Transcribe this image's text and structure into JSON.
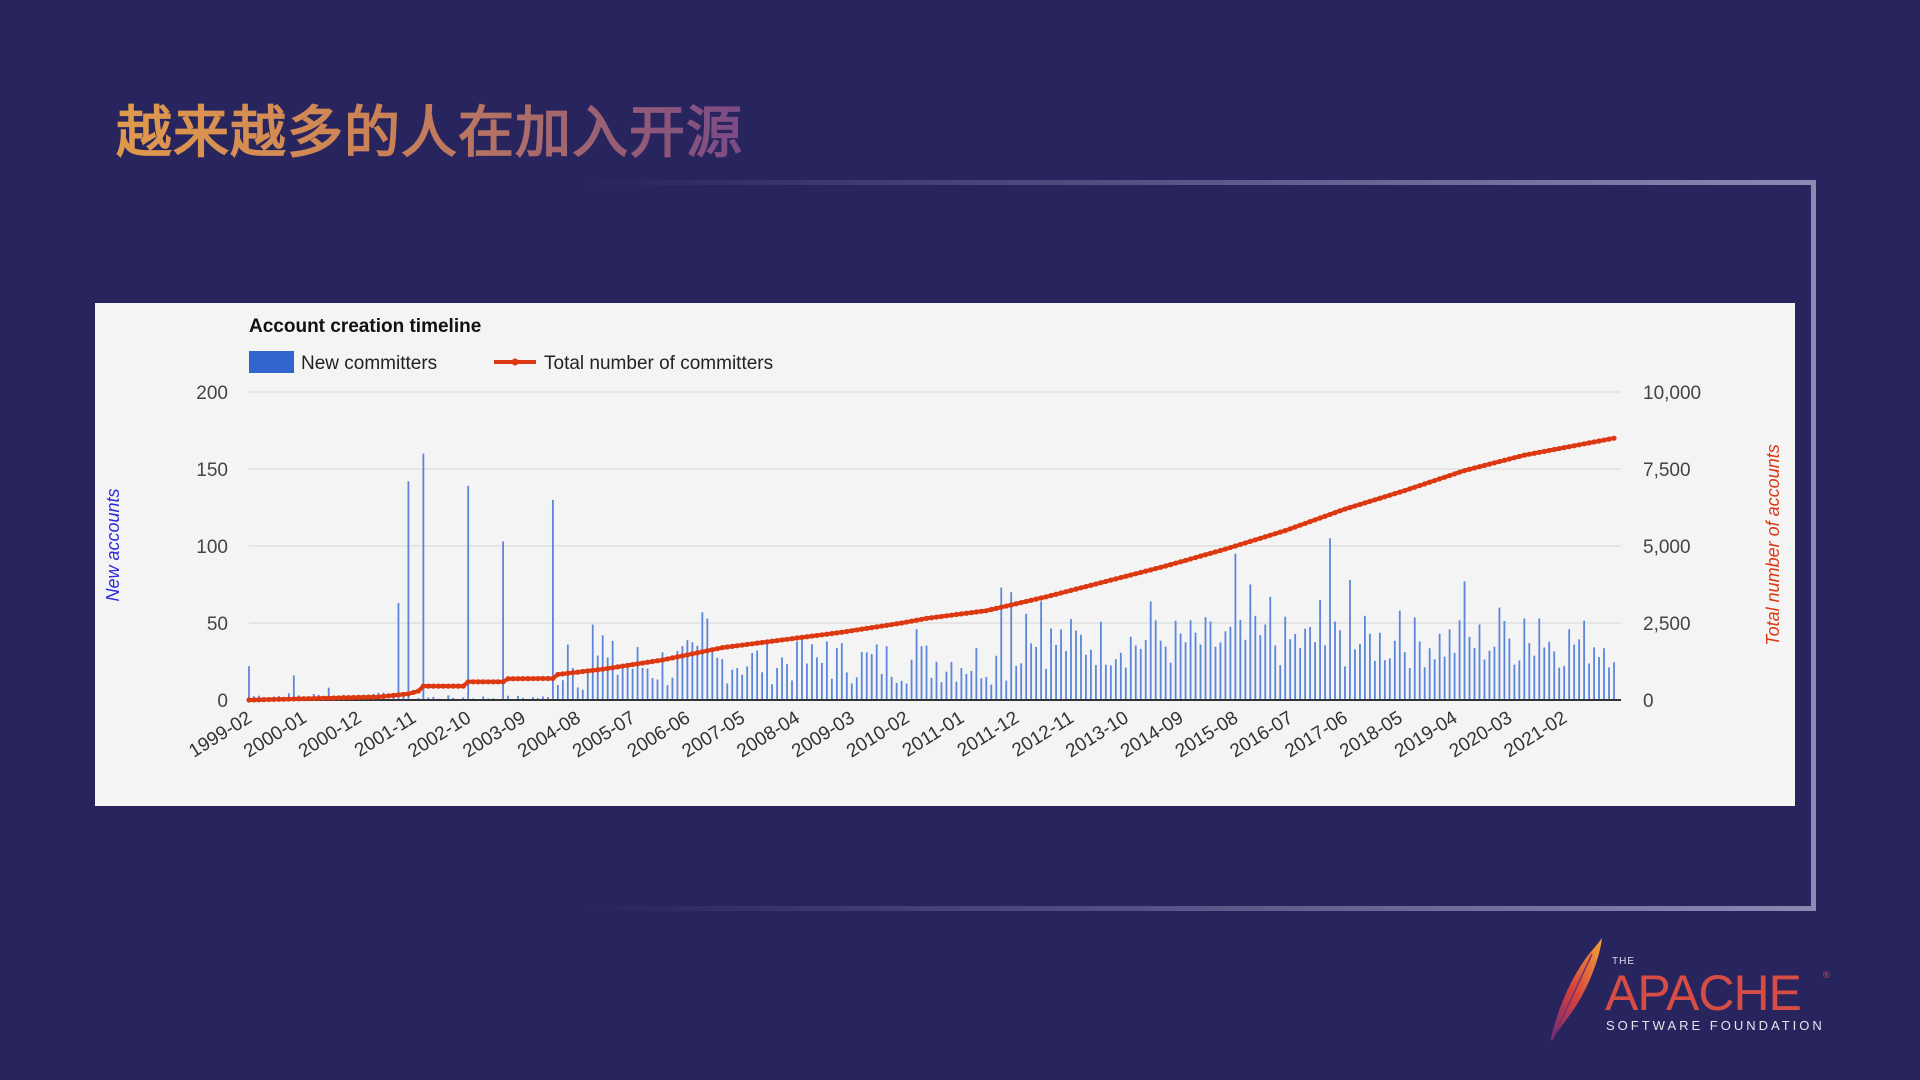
{
  "slide": {
    "title": "越来越多的人在加入开源"
  },
  "logo": {
    "the": "THE",
    "wordmark": "APACHE",
    "reg": "®",
    "subtitle": "SOFTWARE FOUNDATION"
  },
  "colors": {
    "background": "#27245e",
    "bars": "#5b86dc",
    "legend_bar": "#3366cc",
    "line": "#dc3912",
    "left_axis_label": "#2e2ad8",
    "right_axis_label": "#dc3912"
  },
  "chart_data": {
    "type": "bar+line",
    "title": "Account creation timeline",
    "series": [
      {
        "name": "New committers",
        "type": "bar",
        "axis": "left"
      },
      {
        "name": "Total number of committers",
        "type": "line",
        "axis": "right"
      }
    ],
    "ylabel_left": "New accounts",
    "ylabel_right": "Total number of accounts",
    "ylim_left": [
      0,
      200
    ],
    "ylim_right": [
      0,
      10000
    ],
    "yticks_left": [
      "200",
      "150",
      "100",
      "50",
      "0"
    ],
    "yticks_right": [
      "10,000",
      "7,500",
      "5,000",
      "2,500",
      "0"
    ],
    "x_tick_labels": [
      "1999-02",
      "2000-01",
      "2000-12",
      "2001-11",
      "2002-10",
      "2003-09",
      "2004-08",
      "2005-07",
      "2006-06",
      "2007-05",
      "2008-04",
      "2009-03",
      "2010-02",
      "2011-01",
      "2011-12",
      "2012-11",
      "2013-10",
      "2014-09",
      "2015-08",
      "2016-07",
      "2017-06",
      "2018-05",
      "2019-04",
      "2020-03",
      "2021-02"
    ],
    "x_start": "1999-02",
    "x_end": "2021-12",
    "legend_position": "top-left",
    "grid": true,
    "bar_spikes": [
      {
        "date": "1999-02",
        "value": 22
      },
      {
        "date": "1999-11",
        "value": 16
      },
      {
        "date": "2000-06",
        "value": 8
      },
      {
        "date": "2001-03",
        "value": 4
      },
      {
        "date": "2001-08",
        "value": 63
      },
      {
        "date": "2001-10",
        "value": 142
      },
      {
        "date": "2002-01",
        "value": 160
      },
      {
        "date": "2002-10",
        "value": 139
      },
      {
        "date": "2003-05",
        "value": 103
      },
      {
        "date": "2004-03",
        "value": 130
      },
      {
        "date": "2004-06",
        "value": 36
      },
      {
        "date": "2004-11",
        "value": 49
      },
      {
        "date": "2005-01",
        "value": 42
      },
      {
        "date": "2006-09",
        "value": 57
      },
      {
        "date": "2006-10",
        "value": 53
      },
      {
        "date": "2008-04",
        "value": 38
      },
      {
        "date": "2008-10",
        "value": 38
      },
      {
        "date": "2010-04",
        "value": 46
      },
      {
        "date": "2011-09",
        "value": 73
      },
      {
        "date": "2011-11",
        "value": 70
      },
      {
        "date": "2012-02",
        "value": 56
      },
      {
        "date": "2012-05",
        "value": 64
      },
      {
        "date": "2014-03",
        "value": 64
      },
      {
        "date": "2015-08",
        "value": 95
      },
      {
        "date": "2015-11",
        "value": 75
      },
      {
        "date": "2016-03",
        "value": 67
      },
      {
        "date": "2017-01",
        "value": 65
      },
      {
        "date": "2017-03",
        "value": 105
      },
      {
        "date": "2017-07",
        "value": 78
      },
      {
        "date": "2018-05",
        "value": 58
      },
      {
        "date": "2019-06",
        "value": 77
      },
      {
        "date": "2020-01",
        "value": 60
      },
      {
        "date": "2020-06",
        "value": 53
      },
      {
        "date": "2020-09",
        "value": 53
      }
    ],
    "bar_typical_range": {
      "1999-02_to_2001-07": [
        0,
        5
      ],
      "2004-04_to_2006-12": [
        5,
        40
      ],
      "2007-01_to_2011-12": [
        10,
        40
      ],
      "2012-01_to_2021-12": [
        20,
        55
      ]
    },
    "total_points": [
      {
        "date": "1999-02",
        "value": 0
      },
      {
        "date": "2001-04",
        "value": 100
      },
      {
        "date": "2001-10",
        "value": 200
      },
      {
        "date": "2001-12",
        "value": 290
      },
      {
        "date": "2002-01",
        "value": 450
      },
      {
        "date": "2002-09",
        "value": 450
      },
      {
        "date": "2002-10",
        "value": 590
      },
      {
        "date": "2003-05",
        "value": 590
      },
      {
        "date": "2003-06",
        "value": 690
      },
      {
        "date": "2004-03",
        "value": 700
      },
      {
        "date": "2004-04",
        "value": 830
      },
      {
        "date": "2005-01",
        "value": 1000
      },
      {
        "date": "2006-01",
        "value": 1300
      },
      {
        "date": "2007-01",
        "value": 1700
      },
      {
        "date": "2008-01",
        "value": 1950
      },
      {
        "date": "2009-01",
        "value": 2200
      },
      {
        "date": "2010-01",
        "value": 2500
      },
      {
        "date": "2010-06",
        "value": 2650
      },
      {
        "date": "2011-06",
        "value": 2900
      },
      {
        "date": "2012-06",
        "value": 3350
      },
      {
        "date": "2013-06",
        "value": 3850
      },
      {
        "date": "2014-06",
        "value": 4350
      },
      {
        "date": "2015-06",
        "value": 4900
      },
      {
        "date": "2016-06",
        "value": 5500
      },
      {
        "date": "2017-06",
        "value": 6200
      },
      {
        "date": "2018-06",
        "value": 6800
      },
      {
        "date": "2019-06",
        "value": 7450
      },
      {
        "date": "2020-06",
        "value": 7950
      },
      {
        "date": "2021-12",
        "value": 8500
      }
    ]
  }
}
